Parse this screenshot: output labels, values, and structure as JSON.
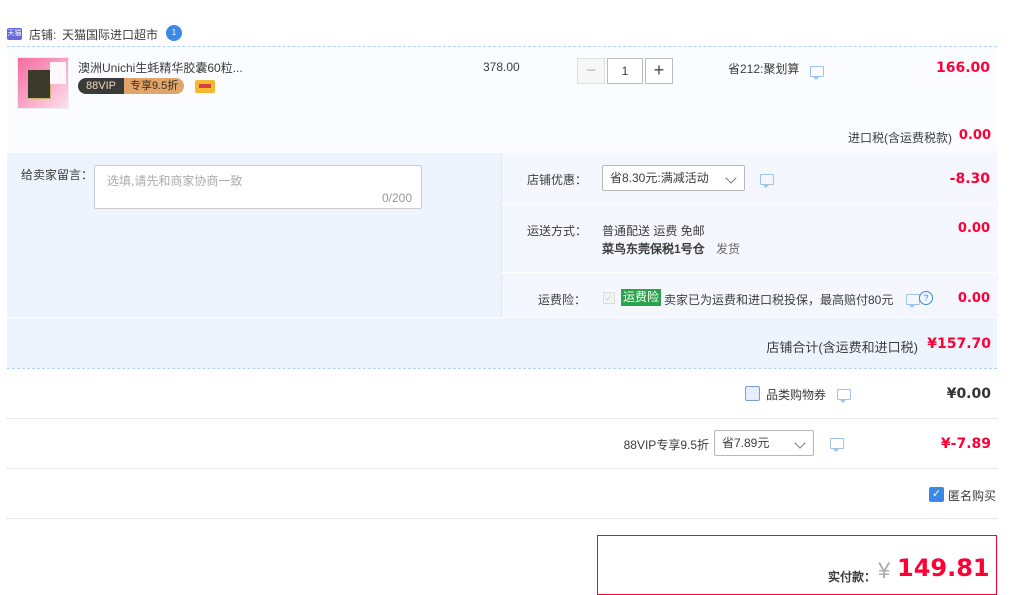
{
  "shop": {
    "badge": "天猫",
    "label": "店铺:",
    "name": "天猫国际进口超市",
    "wangwang_badge": "1"
  },
  "item": {
    "title": "澳洲Unichi生蚝精华胶囊60粒...",
    "vip_logo": "88VIP",
    "vip_discount": "专享9.5折",
    "unit_price": "378.00",
    "quantity": "1",
    "promo": "省212:聚划算",
    "subtotal": "166.00",
    "import_tax_label": "进口税(含运费税款)",
    "import_tax_value": "0.00"
  },
  "message": {
    "label": "给卖家留言：",
    "placeholder": "选填,请先和商家协商一致",
    "counter": "0/200"
  },
  "store_discount": {
    "label": "店铺优惠：",
    "selected": "省8.30元:满减活动",
    "value": "-8.30"
  },
  "shipping": {
    "label": "运送方式：",
    "method": "普通配送 运费 免邮",
    "warehouse": "菜鸟东莞保税1号仓",
    "ship_note": "发货",
    "value": "0.00"
  },
  "insurance": {
    "label": "运费险：",
    "tag": "运费险",
    "desc": "卖家已为运费和进口税投保，最高赔付80元",
    "value": "0.00"
  },
  "store_total": {
    "label": "店铺合计(含运费和进口税)",
    "value": "¥157.70"
  },
  "coupon": {
    "label": "品类购物券",
    "value": "¥0.00",
    "checked": false
  },
  "vip": {
    "label": "88VIP专享9.5折",
    "selected": "省7.89元",
    "value": "¥-7.89"
  },
  "anonymous": {
    "label": "匿名购买",
    "checked": true
  },
  "payment": {
    "label": "实付款：",
    "currency": "¥",
    "amount": "149.81"
  },
  "colors": {
    "accent": "#ff0036",
    "link_blue": "#3c88e6",
    "panel_blue": "#eef4fd",
    "tag_green": "#2aa34a",
    "vip_gold": "#e0a56a"
  }
}
